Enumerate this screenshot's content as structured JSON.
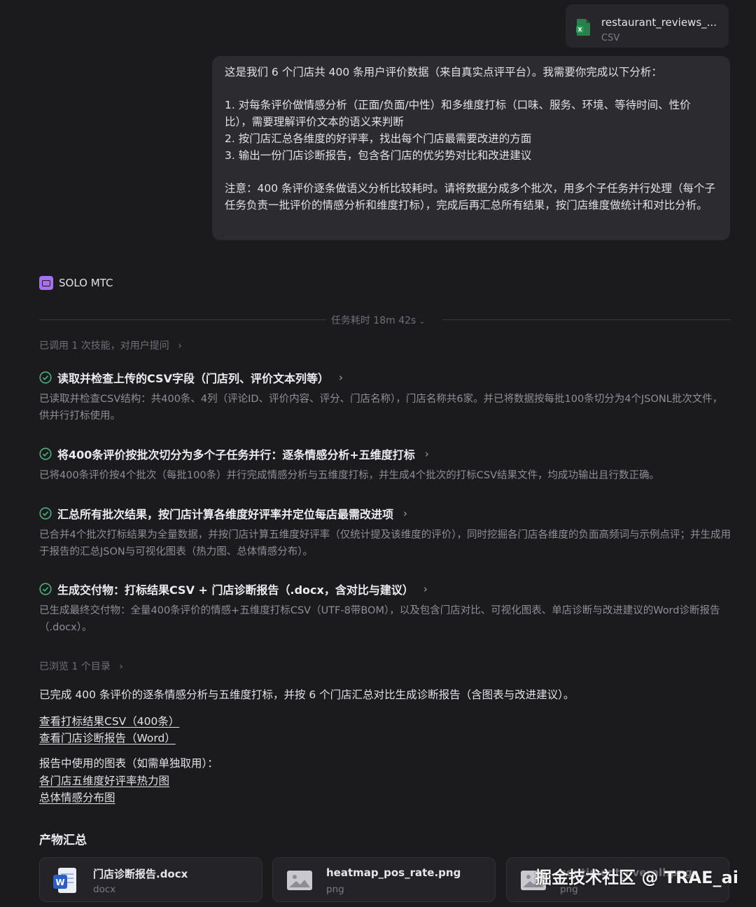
{
  "attachment": {
    "name": "restaurant_reviews_...",
    "type": "CSV"
  },
  "user_message": {
    "intro": "这是我们 6 个门店共 400 条用户评价数据（来自真实点评平台）。我需要你完成以下分析：",
    "item1": "1. 对每条评价做情感分析（正面/负面/中性）和多维度打标（口味、服务、环境、等待时间、性价比），需要理解评价文本的语义来判断",
    "item2": "2. 按门店汇总各维度的好评率，找出每个门店最需要改进的方面",
    "item3": "3. 输出一份门店诊断报告，包含各门店的优劣势对比和改进建议",
    "note": "注意：400 条评价逐条做语义分析比较耗时。请将数据分成多个批次，用多个子任务并行处理（每个子任务负责一批评价的情感分析和维度打标），完成后再汇总所有结果，按门店维度做统计和对比分析。"
  },
  "agent": {
    "name": "SOLO MTC"
  },
  "task_time": "任务耗时 18m 42s",
  "skills_line": "已调用 1 次技能，对用户提问",
  "steps": [
    {
      "title": "读取并检查上传的CSV字段（门店列、评价文本列等）",
      "desc": "已读取并检查CSV结构：共400条、4列（评论ID、评价内容、评分、门店名称），门店名称共6家。并已将数据按每批100条切分为4个JSONL批次文件，供并行打标使用。"
    },
    {
      "title": "将400条评价按批次切分为多个子任务并行：逐条情感分析+五维度打标",
      "desc": "已将400条评价按4个批次（每批100条）并行完成情感分析与五维度打标，并生成4个批次的打标CSV结果文件，均成功输出且行数正确。"
    },
    {
      "title": "汇总所有批次结果，按门店计算各维度好评率并定位每店最需改进项",
      "desc": "已合并4个批次打标结果为全量数据，并按门店计算五维度好评率（仅统计提及该维度的评价），同时挖掘各门店各维度的负面高频词与示例点评；并生成用于报告的汇总JSON与可视化图表（热力图、总体情感分布）。"
    },
    {
      "title": "生成交付物：打标结果CSV + 门店诊断报告（.docx，含对比与建议）",
      "desc": "已生成最终交付物：全量400条评价的情感+五维度打标CSV（UTF-8带BOM），以及包含门店对比、可视化图表、单店诊断与改进建议的Word诊断报告（.docx）。"
    }
  ],
  "browse_line": "已浏览 1 个目录",
  "summary": "已完成 400 条评价的逐条情感分析与五维度打标，并按 6 个门店汇总对比生成诊断报告（含图表与改进建议）。",
  "links": {
    "csv": "查看打标结果CSV（400条）",
    "report": "查看门店诊断报告（Word）",
    "heatmap": "各门店五维度好评率热力图",
    "sentiment": "总体情感分布图"
  },
  "charts_note": "报告中使用的图表（如需单独取用）：",
  "artifacts_title": "产物汇总",
  "artifacts": [
    {
      "name": "门店诊断报告.docx",
      "type": "docx"
    },
    {
      "name": "heatmap_pos_rate.png",
      "type": "png"
    },
    {
      "name": "sentiment_overall.png",
      "type": "png"
    }
  ],
  "watermark": "掘金技术社区 @ TRAE_ai",
  "colors": {
    "background": "#1b1b1e",
    "accent_green": "#4caf7d",
    "agent_purple": "#a770ef"
  }
}
